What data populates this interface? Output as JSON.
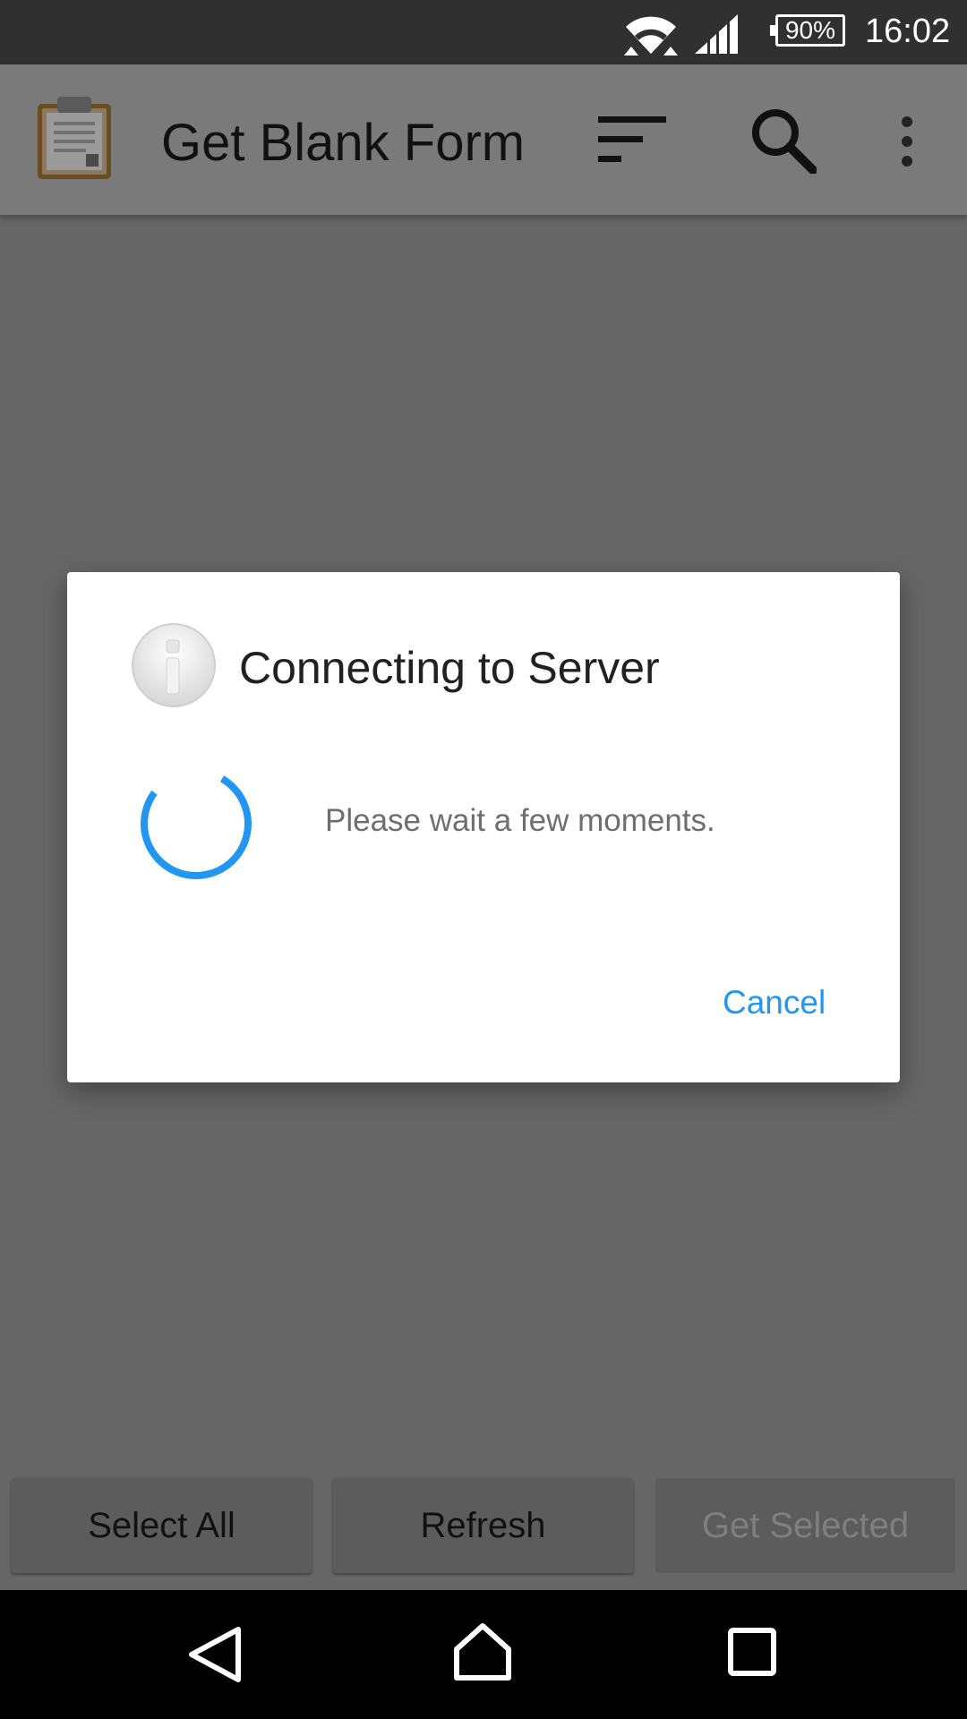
{
  "status_bar": {
    "battery": "90%",
    "time": "16:02",
    "icons": [
      "wifi-icon",
      "cell-signal-icon",
      "battery-icon"
    ]
  },
  "action_bar": {
    "title": "Get Blank Form",
    "icons": [
      "clipboard-icon",
      "sort-icon",
      "search-icon",
      "overflow-menu-icon"
    ]
  },
  "dialog": {
    "title": "Connecting to Server",
    "message": "Please wait a few moments.",
    "cancel_label": "Cancel",
    "icons": [
      "info-icon",
      "progress-spinner"
    ]
  },
  "bottom_buttons": {
    "select_all": "Select All",
    "refresh": "Refresh",
    "get_selected": "Get Selected"
  },
  "colors": {
    "accent": "#2196F3",
    "scrim": "#666666",
    "status_bar": "#303030"
  }
}
